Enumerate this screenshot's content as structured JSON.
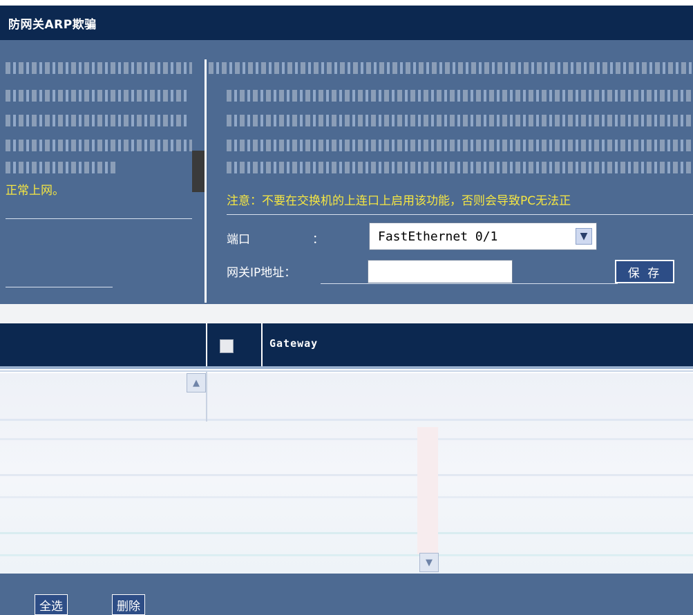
{
  "title": "防网关ARP欺骗",
  "left_panel": {
    "warning_tail": "正常上网。"
  },
  "right_panel": {
    "warning": "注意：不要在交换机的上连口上启用该功能，否则会导致PC无法正",
    "port_label": "端口",
    "port_colon": "：",
    "port_value": "FastEthernet 0/1",
    "gateway_ip_label": "网关IP地址：",
    "gateway_ip_value": "",
    "save_label": "保 存"
  },
  "table": {
    "gateway_header": "Gateway"
  },
  "footer": {
    "select_all_label": "全选",
    "delete_label": "删除"
  },
  "colors": {
    "header_navy": "#0c2850",
    "panel_blue": "#4d6a92",
    "warning_yellow": "#f5e642"
  }
}
